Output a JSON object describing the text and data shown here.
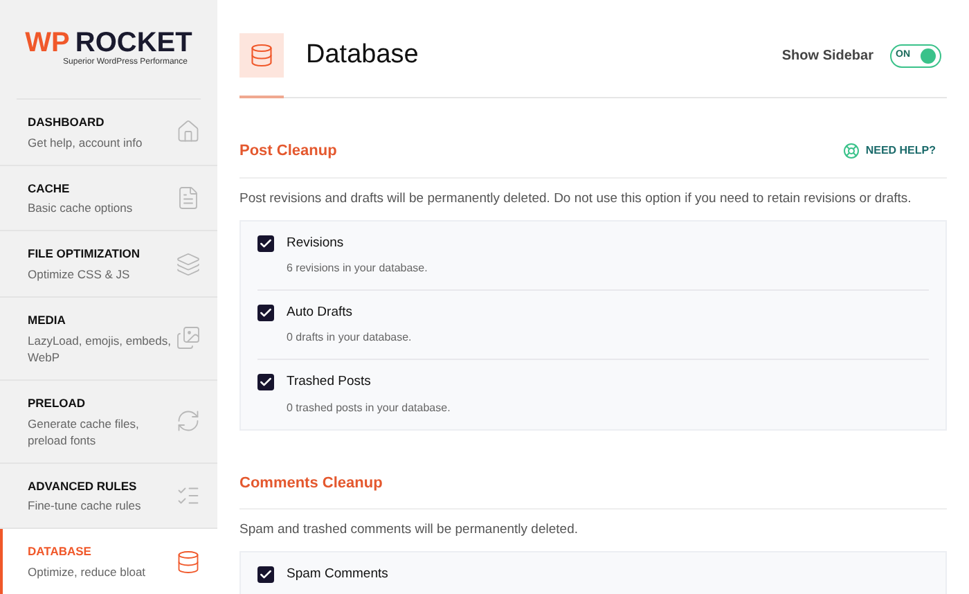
{
  "logo": {
    "brand_first": "WP",
    "brand_second": "ROCKET",
    "tagline": "Superior WordPress Performance"
  },
  "sidebar": {
    "items": [
      {
        "title": "DASHBOARD",
        "subtitle": "Get help, account info",
        "selected": false
      },
      {
        "title": "CACHE",
        "subtitle": "Basic cache options",
        "selected": false
      },
      {
        "title": "FILE OPTIMIZATION",
        "subtitle": "Optimize CSS & JS",
        "selected": false
      },
      {
        "title": "MEDIA",
        "subtitle": "LazyLoad, emojis, embeds, WebP",
        "selected": false
      },
      {
        "title": "PRELOAD",
        "subtitle": "Generate cache files, preload fonts",
        "selected": false
      },
      {
        "title": "ADVANCED RULES",
        "subtitle": "Fine-tune cache rules",
        "selected": false
      },
      {
        "title": "DATABASE",
        "subtitle": "Optimize, reduce bloat",
        "selected": true
      }
    ]
  },
  "header": {
    "title": "Database",
    "sidebar_toggle": {
      "label": "Show Sidebar",
      "state_text": "ON",
      "on": true
    }
  },
  "sections": [
    {
      "title": "Post Cleanup",
      "help_link": "NEED HELP?",
      "description": "Post revisions and drafts will be permanently deleted. Do not use this option if you need to retain revisions or drafts.",
      "options": [
        {
          "label": "Revisions",
          "detail": "6 revisions in your database.",
          "checked": true
        },
        {
          "label": "Auto Drafts",
          "detail": "0 drafts in your database.",
          "checked": true
        },
        {
          "label": "Trashed Posts",
          "detail": "0 trashed posts in your database.",
          "checked": true
        }
      ]
    },
    {
      "title": "Comments Cleanup",
      "description": "Spam and trashed comments will be permanently deleted.",
      "options": [
        {
          "label": "Spam Comments",
          "checked": true
        }
      ]
    }
  ]
}
